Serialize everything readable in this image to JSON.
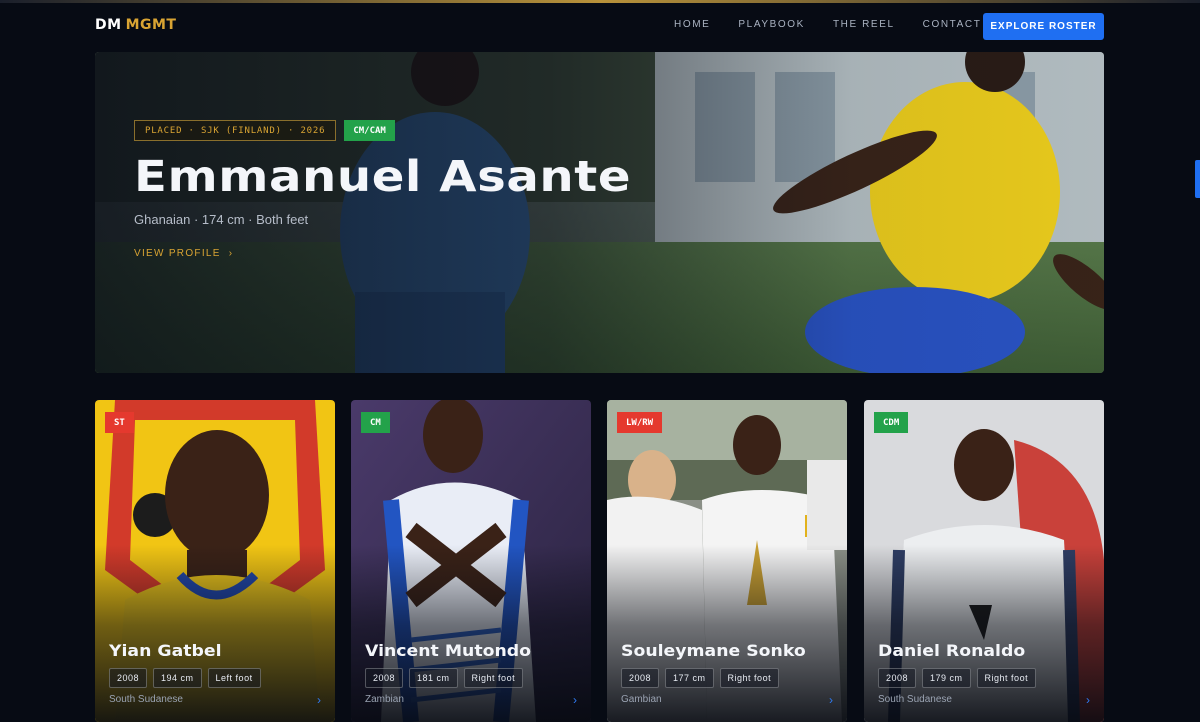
{
  "brand": {
    "dm": "DM",
    "mgmt": "MGMT"
  },
  "nav": {
    "links": [
      "HOME",
      "PLAYBOOK",
      "THE REEL",
      "CONTACT"
    ],
    "cta": "EXPLORE ROSTER"
  },
  "hero": {
    "placed": "PLACED · SJK (FINLAND) · 2026",
    "position": "CM/CAM",
    "name": "Emmanuel Asante",
    "meta": "Ghanaian · 174 cm · Both feet",
    "link": "VIEW PROFILE",
    "chevron": "›"
  },
  "players": [
    {
      "position": "ST",
      "name": "Yian Gatbel",
      "year": "2008",
      "height": "194 cm",
      "foot": "Left foot",
      "nationality": "South Sudanese",
      "arrow": "›"
    },
    {
      "position": "CM",
      "name": "Vincent Mutondo",
      "year": "2008",
      "height": "181 cm",
      "foot": "Right foot",
      "nationality": "Zambian",
      "arrow": "›"
    },
    {
      "position": "LW/RW",
      "name": "Souleymane Sonko",
      "year": "2008",
      "height": "177 cm",
      "foot": "Right foot",
      "nationality": "Gambian",
      "arrow": "›"
    },
    {
      "position": "CDM",
      "name": "Daniel Ronaldo",
      "year": "2008",
      "height": "179 cm",
      "foot": "Right foot",
      "nationality": "South Sudanese",
      "arrow": "›"
    }
  ],
  "colors": {
    "accent_gold": "#d9a433",
    "cta_blue": "#1f6ff2",
    "badge_green": "#23a24a",
    "badge_red": "#e5392e",
    "background": "#070b14"
  }
}
